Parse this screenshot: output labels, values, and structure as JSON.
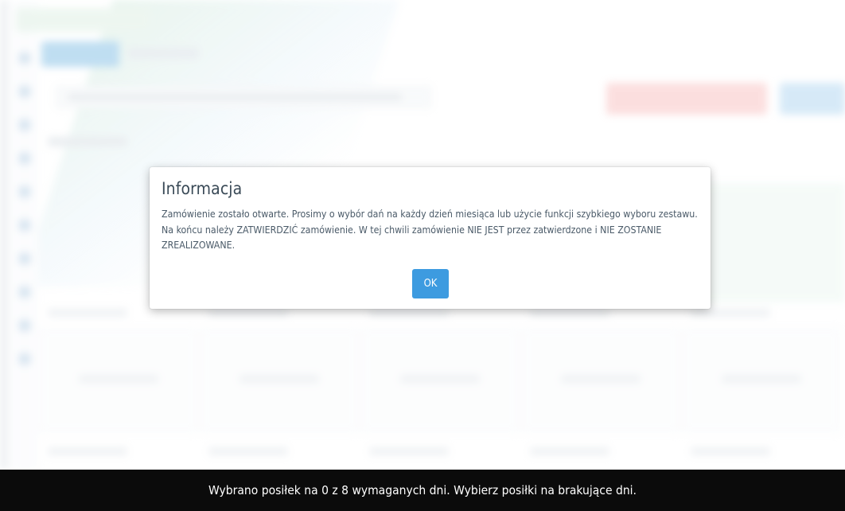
{
  "modal": {
    "title": "Informacja",
    "body_line_1": "Zamówienie zostało otwarte. Prosimy o wybór dań na każdy dzień miesiąca lub użycie funkcji szybkiego wyboru zestawu.",
    "body_line_2": "Na końcu należy ZATWIERDZIĆ zamówienie. W tej chwili zamówienie NIE JEST przez zatwierdzone i NIE ZOSTANIE ZREALIZOWANE.",
    "ok_label": "OK"
  },
  "status_bar": {
    "message": "Wybrano posiłek na 0 z 8 wymaganych dni. Wybierz posiłki na brakujące dni."
  },
  "colors": {
    "primary_button": "#3d9be0",
    "status_bar_bg": "#0b0b0b",
    "modal_title": "#3a4a57",
    "modal_text": "#4a5a68"
  }
}
